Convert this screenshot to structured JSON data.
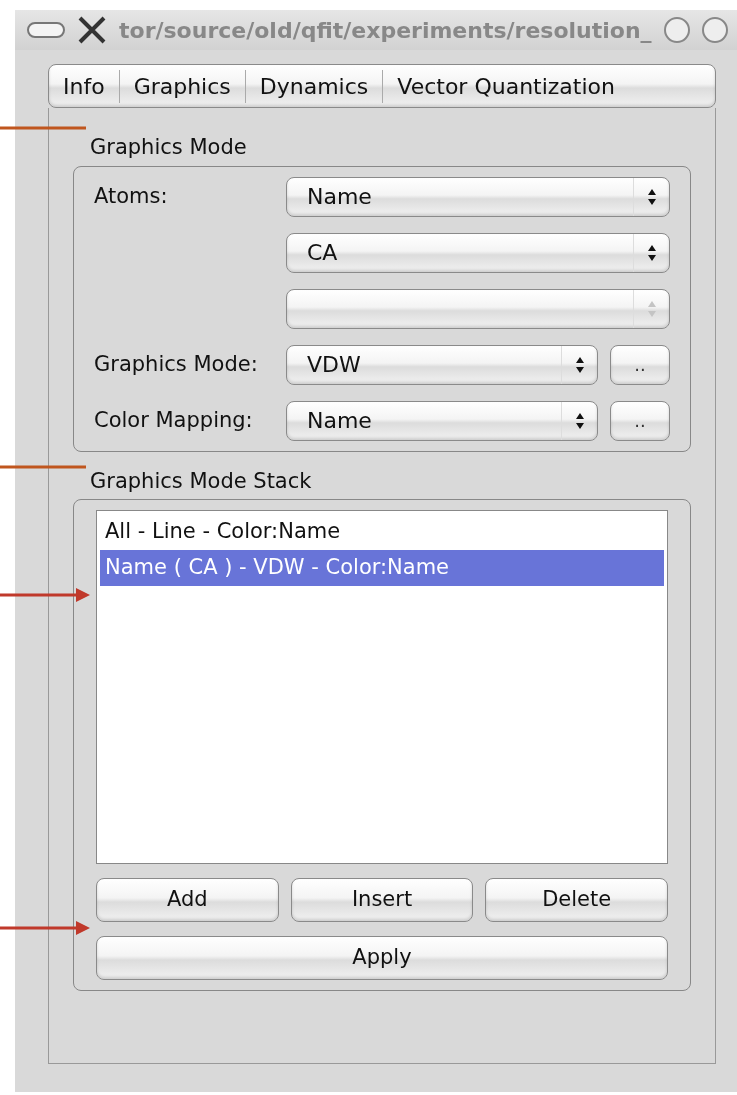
{
  "window": {
    "title": "tor/source/old/qfit/experiments/resolution_"
  },
  "tabs": [
    {
      "label": "Info"
    },
    {
      "label": "Graphics"
    },
    {
      "label": "Dynamics"
    },
    {
      "label": "Vector Quantization"
    }
  ],
  "graphics_mode": {
    "title": "Graphics Mode",
    "rows": [
      {
        "label": "Atoms:",
        "value": "Name",
        "disabled": false,
        "has_more_button": false
      },
      {
        "value": "CA",
        "disabled": false,
        "has_more_button": false
      },
      {
        "value": "",
        "disabled": true,
        "has_more_button": false
      },
      {
        "label": "Graphics Mode:",
        "value": "VDW",
        "disabled": false,
        "has_more_button": true,
        "more_label": ".."
      },
      {
        "label": "Color Mapping:",
        "value": "Name",
        "disabled": false,
        "has_more_button": true,
        "more_label": ".."
      }
    ]
  },
  "stack": {
    "title": "Graphics Mode Stack",
    "items": [
      {
        "label": "All - Line - Color:Name",
        "selected": false
      },
      {
        "label": "Name ( CA ) - VDW - Color:Name",
        "selected": true
      }
    ],
    "buttons": [
      "Add",
      "Insert",
      "Delete"
    ],
    "apply": "Apply"
  },
  "annotations": [
    {
      "kind": "line",
      "color": "#c0561e"
    },
    {
      "kind": "line",
      "color": "#c0561e"
    },
    {
      "kind": "arrow",
      "color": "#c0392b"
    },
    {
      "kind": "arrow",
      "color": "#c0392b"
    }
  ]
}
